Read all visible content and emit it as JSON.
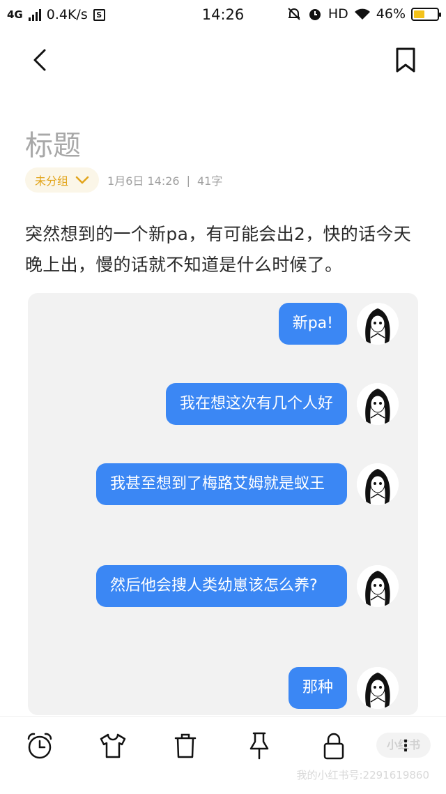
{
  "status_bar": {
    "network": "4G",
    "speed": "0.4K/s",
    "app_badge": "S",
    "time": "14:26",
    "hd": "HD",
    "battery_percent_text": "46%",
    "battery_level": 0.46
  },
  "nav": {
    "back_icon": "chevron-left-icon",
    "bookmark_icon": "bookmark-icon"
  },
  "note": {
    "title_placeholder": "标题",
    "group_label": "未分组",
    "date": "1月6日 14:26",
    "separator": "|",
    "word_count": "41字",
    "body": "突然想到的一个新pa，有可能会出2，快的话今天晚上出，慢的话就不知道是什么时候了。"
  },
  "chat": {
    "messages": [
      {
        "text": "新pa!"
      },
      {
        "text": "我在想这次有几个人好"
      },
      {
        "text": "我甚至想到了梅路艾姆就是蚁王"
      },
      {
        "text": "然后他会搜人类幼崽该怎么养?"
      },
      {
        "text": "那种"
      }
    ],
    "bubble_color": "#3b87f4"
  },
  "toolbar": {
    "icons": [
      "alarm-clock-icon",
      "shirt-icon",
      "trash-icon",
      "pin-icon",
      "lock-icon",
      "more-icon"
    ],
    "more_label": "⋮"
  },
  "watermark": {
    "pill": "小红书",
    "text": "我的小红书号:2291619860"
  },
  "colors": {
    "accent": "#e2a41a",
    "bubble": "#3b87f4",
    "title_gray": "#a8a8a8"
  }
}
